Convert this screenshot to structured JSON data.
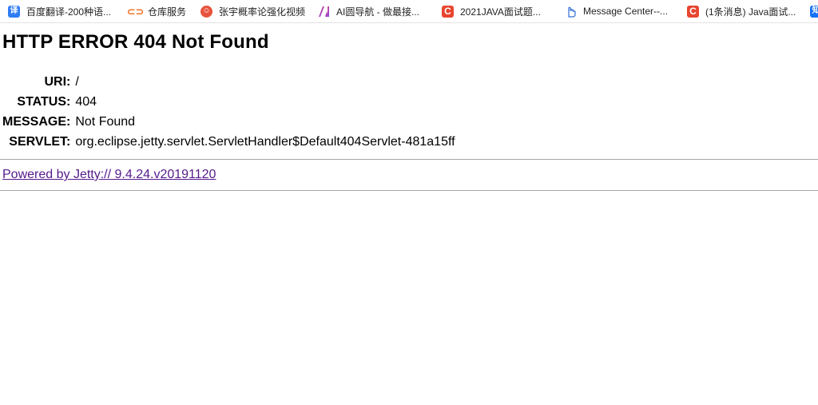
{
  "bookmarks": [
    {
      "label": "百度翻译-200种语...",
      "icon": "translate-icon",
      "glyph": "译"
    },
    {
      "label": "仓库服务",
      "icon": "repository-icon",
      "glyph": "⊂⊃"
    },
    {
      "label": "张宇概率论强化视频",
      "icon": "face-icon",
      "glyph": "☺"
    },
    {
      "label": "AI圆导航 - 做最接...",
      "icon": "ai-logo-icon",
      "glyph": "A"
    },
    {
      "label": "2021JAVA面试题...",
      "icon": "csdn-icon",
      "glyph": "C"
    },
    {
      "label": "Message Center--...",
      "icon": "hand-icon",
      "glyph": "☝"
    },
    {
      "label": "(1条消息) Java面试...",
      "icon": "csdn-icon",
      "glyph": "C"
    },
    {
      "label": "",
      "icon": "zhihu-icon",
      "glyph": "知"
    }
  ],
  "page": {
    "title": "HTTP ERROR 404 Not Found",
    "rows": [
      {
        "key": "URI:",
        "value": "/"
      },
      {
        "key": "STATUS:",
        "value": "404"
      },
      {
        "key": "MESSAGE:",
        "value": "Not Found"
      },
      {
        "key": "SERVLET:",
        "value": "org.eclipse.jetty.servlet.ServletHandler$Default404Servlet-481a15ff"
      }
    ],
    "powered_by": "Powered by Jetty:// 9.4.24.v20191120"
  },
  "colors": {
    "link_visited": "#551a8b",
    "rule": "#a6a6a6",
    "csdn": "#e8452f",
    "translate": "#2f7cf6"
  }
}
